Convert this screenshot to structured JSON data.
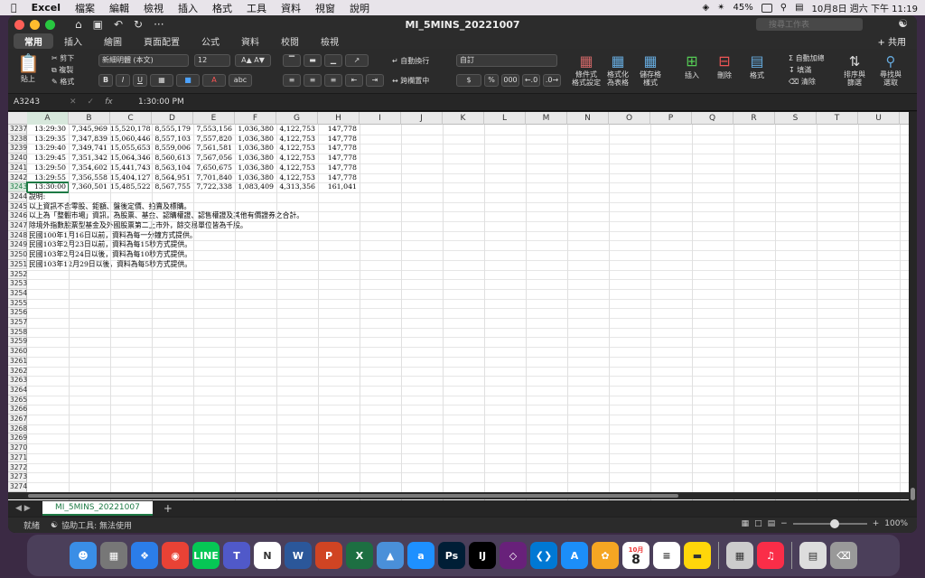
{
  "menubar": {
    "app": "Excel",
    "items": [
      "檔案",
      "編輯",
      "檢視",
      "插入",
      "格式",
      "工具",
      "資料",
      "視窗",
      "說明"
    ],
    "battery": "45%",
    "datetime": "10月8日 週六 下午 11:19"
  },
  "window": {
    "title": "MI_5MINS_20221007",
    "search_placeholder": "搜尋工作表",
    "share": "共用"
  },
  "ribbon_tabs": [
    "常用",
    "插入",
    "繪圖",
    "頁面配置",
    "公式",
    "資料",
    "校閱",
    "檢視"
  ],
  "ribbon": {
    "paste": "貼上",
    "cut": "剪下",
    "copy": "複製",
    "format_painter": "格式",
    "font_name": "新細明體 (本文)",
    "font_size": "12",
    "wrap": "自動換行",
    "merge": "跨欄置中",
    "number_format": "自訂",
    "currency": "$",
    "percent": "%",
    "cond_format": "條件式\n格式設定",
    "format_table": "格式化\n為表格",
    "cell_styles": "儲存格\n樣式",
    "insert": "插入",
    "delete": "刪除",
    "format": "格式",
    "autosum": "自動加總",
    "fill": "填滿",
    "clear": "清除",
    "sort_filter": "排序與\n篩選",
    "find_select": "尋找與\n選取"
  },
  "formula_bar": {
    "name_box": "A3243",
    "value": "1:30:00 PM"
  },
  "columns": [
    "A",
    "B",
    "C",
    "D",
    "E",
    "F",
    "G",
    "H",
    "I",
    "J",
    "K",
    "L",
    "M",
    "N",
    "O",
    "P",
    "Q",
    "R",
    "S",
    "T",
    "U"
  ],
  "rows": [
    {
      "n": "3237",
      "cells": [
        "13:29:30",
        "7,345,969",
        "15,520,178",
        "8,555,179",
        "7,553,156",
        "1,036,380",
        "4,122,753",
        "147,778"
      ]
    },
    {
      "n": "3238",
      "cells": [
        "13:29:35",
        "7,347,839",
        "15,060,446",
        "8,557,103",
        "7,557,820",
        "1,036,380",
        "4,122,753",
        "147,778"
      ]
    },
    {
      "n": "3239",
      "cells": [
        "13:29:40",
        "7,349,741",
        "15,055,653",
        "8,559,006",
        "7,561,581",
        "1,036,380",
        "4,122,753",
        "147,778"
      ]
    },
    {
      "n": "3240",
      "cells": [
        "13:29:45",
        "7,351,342",
        "15,064,346",
        "8,560,613",
        "7,567,056",
        "1,036,380",
        "4,122,753",
        "147,778"
      ]
    },
    {
      "n": "3241",
      "cells": [
        "13:29:50",
        "7,354,602",
        "15,441,743",
        "8,563,104",
        "7,650,675",
        "1,036,380",
        "4,122,753",
        "147,778"
      ]
    },
    {
      "n": "3242",
      "cells": [
        "13:29:55",
        "7,356,558",
        "15,404,127",
        "8,564,951",
        "7,701,840",
        "1,036,380",
        "4,122,753",
        "147,778"
      ]
    },
    {
      "n": "3243",
      "cells": [
        "13:30:00",
        "7,360,501",
        "15,485,522",
        "8,567,755",
        "7,722,338",
        "1,083,409",
        "4,313,356",
        "161,041"
      ]
    },
    {
      "n": "3244",
      "text": "說明:"
    },
    {
      "n": "3245",
      "text": "以上資訊不含零股、鉅額、盤後定價、拍賣及標購。"
    },
    {
      "n": "3246",
      "text": "以上為「整體市場」資訊，為股票、基金、認購權證、認售權證及其他有價證券之合計。"
    },
    {
      "n": "3247",
      "text": "除境外指數股票型基金及外國股票第二上市外，餘交易單位皆為千股。"
    },
    {
      "n": "3248",
      "text": "民國100年1月16日以前，資料為每一分鐘方式提供。"
    },
    {
      "n": "3249",
      "text": "民國103年2月23日以前，資料為每15秒方式提供。"
    },
    {
      "n": "3250",
      "text": "民國103年2月24日以後，資料為每10秒方式提供。"
    },
    {
      "n": "3251",
      "text": "民國103年12月29日以後，資料為每5秒方式提供。"
    },
    {
      "n": "3252"
    },
    {
      "n": "3253"
    },
    {
      "n": "3254"
    },
    {
      "n": "3255"
    },
    {
      "n": "3256"
    },
    {
      "n": "3257"
    },
    {
      "n": "3258"
    },
    {
      "n": "3259"
    },
    {
      "n": "3260"
    },
    {
      "n": "3261"
    },
    {
      "n": "3262"
    },
    {
      "n": "3263"
    },
    {
      "n": "3264"
    },
    {
      "n": "3265"
    },
    {
      "n": "3266"
    },
    {
      "n": "3267"
    },
    {
      "n": "3268"
    },
    {
      "n": "3269"
    },
    {
      "n": "3270"
    },
    {
      "n": "3271"
    },
    {
      "n": "3272"
    },
    {
      "n": "3273"
    },
    {
      "n": "3274"
    }
  ],
  "sheet": {
    "tab": "MI_5MINS_20221007"
  },
  "status": {
    "ready": "就緒",
    "accessibility": "協助工具: 無法使用",
    "zoom": "100%"
  },
  "dock": [
    "Finder",
    "Launchpad",
    "Safari",
    "Chrome",
    "LINE",
    "Teams",
    "Notion",
    "Word",
    "PowerPoint",
    "Excel",
    "Maps",
    "Translate",
    "Photoshop",
    "IntelliJ",
    "Visual Studio",
    "VS Code",
    "App Store",
    "Photos",
    "Calendar",
    "Reminders",
    "Notes",
    "Preview",
    "Music",
    "Finder Window",
    "Trash"
  ],
  "calendar": {
    "month": "10月",
    "day": "8"
  }
}
